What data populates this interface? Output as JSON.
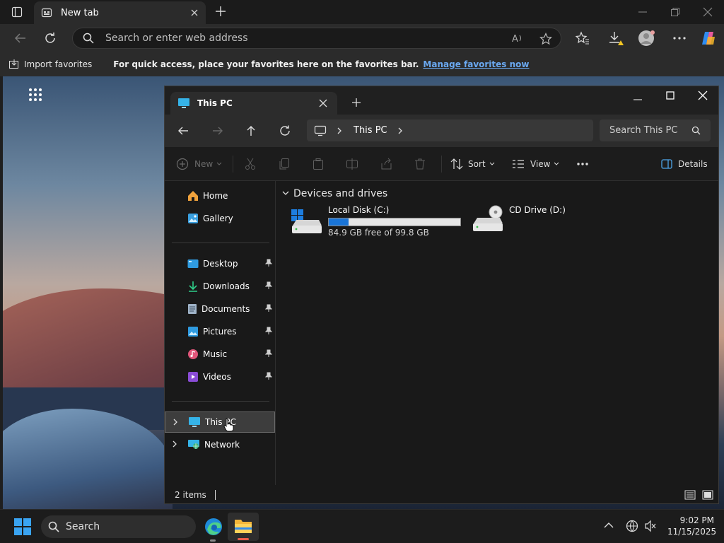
{
  "browser": {
    "tab_title": "New tab",
    "address_placeholder": "Search or enter web address",
    "favorites": {
      "import_label": "Import favorites",
      "hint": "For quick access, place your favorites here on the favorites bar.",
      "manage_link": "Manage favorites now"
    }
  },
  "explorer": {
    "tab_title": "This PC",
    "breadcrumb": [
      "This PC"
    ],
    "search_placeholder": "Search This PC",
    "commands": {
      "new": "New",
      "sort": "Sort",
      "view": "View",
      "details": "Details"
    },
    "sidebar": {
      "top": [
        {
          "label": "Home",
          "icon": "home-icon"
        },
        {
          "label": "Gallery",
          "icon": "gallery-icon"
        }
      ],
      "pinned": [
        {
          "label": "Desktop",
          "icon": "desktop-folder-icon"
        },
        {
          "label": "Downloads",
          "icon": "download-icon"
        },
        {
          "label": "Documents",
          "icon": "documents-icon"
        },
        {
          "label": "Pictures",
          "icon": "pictures-icon"
        },
        {
          "label": "Music",
          "icon": "music-icon"
        },
        {
          "label": "Videos",
          "icon": "videos-icon"
        }
      ],
      "bottom": [
        {
          "label": "This PC",
          "icon": "pc-icon",
          "selected": true
        },
        {
          "label": "Network",
          "icon": "network-icon"
        }
      ]
    },
    "group_title": "Devices and drives",
    "drives": [
      {
        "name": "Local Disk (C:)",
        "free_text": "84.9 GB free of 99.8 GB",
        "used_fraction": 0.15,
        "icon": "hard-drive-icon"
      },
      {
        "name": "CD Drive (D:)",
        "icon": "cd-drive-icon"
      }
    ],
    "status": "2 items"
  },
  "taskbar": {
    "search_label": "Search",
    "time": "9:02 PM",
    "date": "11/15/2025"
  },
  "colors": {
    "accent": "#1a75d8",
    "link": "#6aa8f0"
  }
}
